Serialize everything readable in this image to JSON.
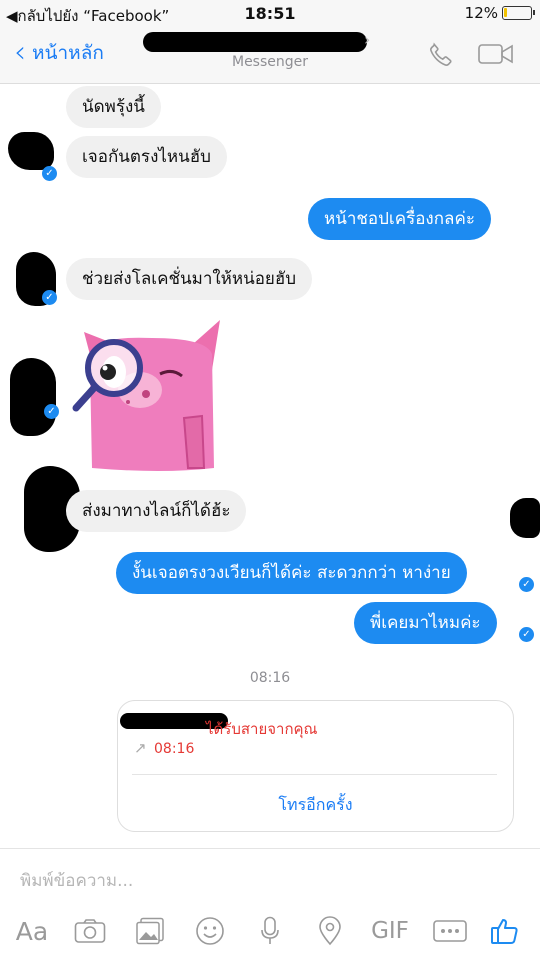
{
  "status_bar": {
    "back_label": "◀กลับไปยัง “Facebook”",
    "time": "18:51",
    "battery": "12%",
    "battery_level": 0.12
  },
  "header": {
    "back_label": "หน้าหลัก",
    "subtitle": "Messenger",
    "call_icon": "phone-icon",
    "video_icon": "video-camera-icon"
  },
  "messages": [
    {
      "side": "in",
      "text": "นัดพรุ้งนี้"
    },
    {
      "side": "in",
      "text": "เจอกันตรงไหนฮับ"
    },
    {
      "side": "out",
      "text": "หน้าชอปเครื่องกลค่ะ"
    },
    {
      "side": "in",
      "text": "ช่วยส่งโลเคชั่นมาให้หน่อยฮับ"
    },
    {
      "side": "in",
      "sticker": "pink-pig-magnifier-sticker"
    },
    {
      "side": "in",
      "text": "ส่งมาทางไลน์ก็ได้ฮ้ะ"
    },
    {
      "side": "out",
      "text": "งั้นเจอตรงวงเวียนก็ได้ค่ะ สะดวกกว่า หาง่าย"
    },
    {
      "side": "out",
      "text": "พี่เคยมาไหมค่ะ"
    }
  ],
  "time_divider": "08:16",
  "call_card": {
    "title": "ได้รับสายจากคุณ",
    "time": "08:16",
    "action": "โทรอีกครั้ง"
  },
  "composer": {
    "placeholder": "พิมพ์ข้อความ...",
    "tools": [
      "Aa",
      "camera-icon",
      "gallery-icon",
      "emoji-icon",
      "microphone-icon",
      "location-pin-icon",
      "GIF",
      "more-icon",
      "thumbs-up-icon"
    ]
  },
  "colors": {
    "accent": "#1d8bf1",
    "incoming_bubble": "#f0f0f0",
    "missed_call": "#e53935"
  }
}
